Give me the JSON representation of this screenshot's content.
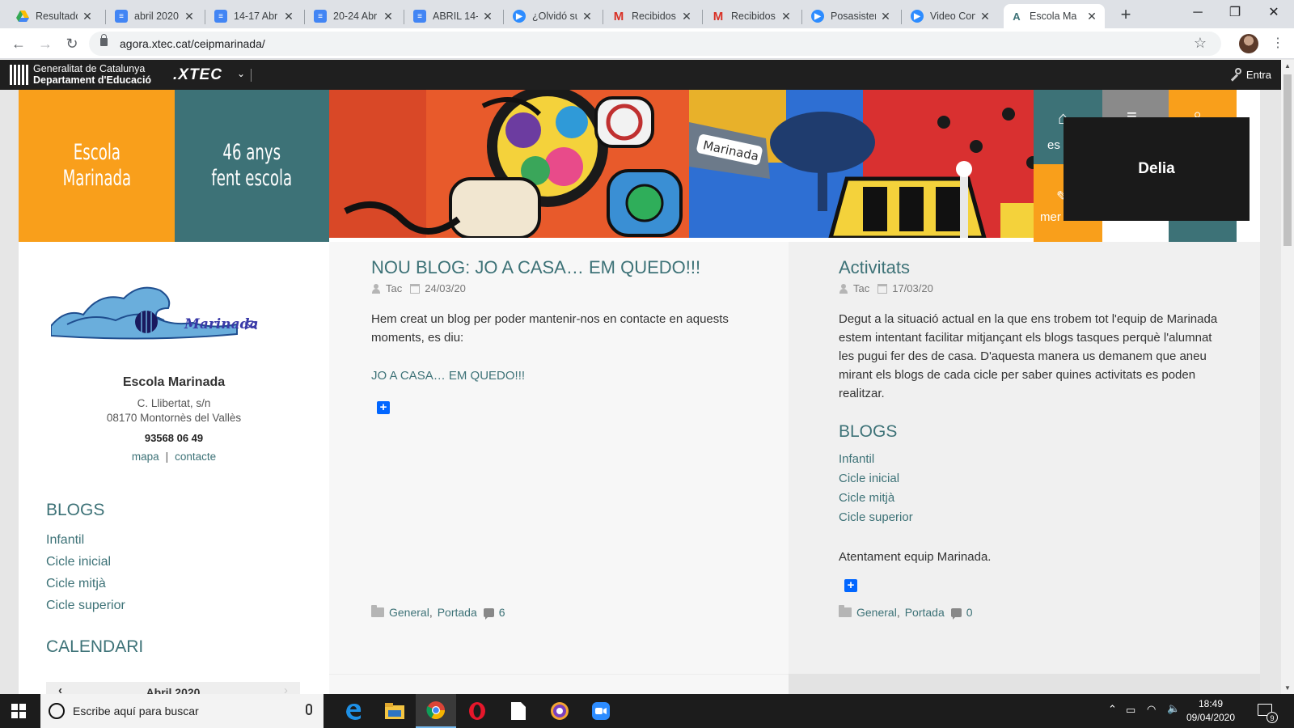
{
  "browser": {
    "tabs": [
      {
        "title": "Resultado",
        "favicon": "google-drive-icon",
        "color": "#34a853"
      },
      {
        "title": "abril 2020",
        "favicon": "google-docs-icon",
        "color": "#4285f4"
      },
      {
        "title": "14-17 Abr",
        "favicon": "google-docs-icon",
        "color": "#4285f4"
      },
      {
        "title": "20-24 Abr",
        "favicon": "google-docs-icon",
        "color": "#4285f4"
      },
      {
        "title": "ABRIL 14-",
        "favicon": "google-docs-icon",
        "color": "#4285f4"
      },
      {
        "title": "¿Olvidó su",
        "favicon": "zoom-icon",
        "color": "#2d8cff"
      },
      {
        "title": "Recibidos",
        "favicon": "gmail-icon",
        "color": "#d93025"
      },
      {
        "title": "Recibidos",
        "favicon": "gmail-icon",
        "color": "#d93025"
      },
      {
        "title": "Posasisten",
        "favicon": "zoom-icon",
        "color": "#2d8cff"
      },
      {
        "title": "Video Con",
        "favicon": "zoom-icon",
        "color": "#2d8cff"
      },
      {
        "title": "Escola Ma",
        "favicon": "agora-icon",
        "color": "#3d7277"
      }
    ],
    "url": "agora.xtec.cat/ceipmarinada/"
  },
  "site_bar": {
    "gencat_line1": "Generalitat de Catalunya",
    "gencat_line2": "Departament d'Educació",
    "xtec": ".XTEC",
    "login": "Entra"
  },
  "header": {
    "tile1_line1": "Escola",
    "tile1_line2": "Marinada",
    "tile2_line1": "46 anys",
    "tile2_line2": "fent escola",
    "nav_label_1": "es",
    "nav_label_2": "mer",
    "accent_orange": "#f99f1b",
    "accent_teal": "#3d7277"
  },
  "sidebar": {
    "logo_text": "Marinada",
    "school_name": "Escola Marinada",
    "address_line1": "C. Llibertat, s/n",
    "address_line2": "08170 Montornès del Vallès",
    "phone": "93568 06 49",
    "link_map": "mapa",
    "link_separator": "|",
    "link_contact": "contacte",
    "blogs_heading": "BLOGS",
    "blogs": [
      "Infantil",
      "Cicle inicial",
      "Cicle mitjà",
      "Cicle superior"
    ],
    "calendar_heading": "CALENDARI",
    "calendar_month": "Abril 2020",
    "calendar_prev": "‹",
    "calendar_next": "›"
  },
  "post1": {
    "title": "NOU BLOG: JO A CASA… EM QUEDO!!!",
    "author": "Tac",
    "date": "24/03/20",
    "body_line1": "Hem creat un blog per poder mantenir-nos en contacte en aquests",
    "body_line2": "moments, es diu:",
    "link": "JO A CASA… EM QUEDO!!!",
    "share": "+",
    "category1": "General",
    "category2": "Portada",
    "comments": "6"
  },
  "post2": {
    "title": "Activitats",
    "author": "Tac",
    "date": "17/03/20",
    "body": [
      "Degut a la situació actual en la que ens trobem tot l'equip de Marinada",
      "estem intentant facilitar mitjançant els blogs tasques perquè l'alumnat",
      "les pugui fer des de casa. D'aquesta manera us demanem que aneu",
      "mirant els blogs de cada cicle per saber quines activitats es poden",
      "realitzar."
    ],
    "blogs_heading": "BLOGS",
    "blogs": [
      "Infantil",
      "Cicle inicial",
      "Cicle mitjà",
      "Cicle superior"
    ],
    "signoff": "Atentament equip Marinada.",
    "share": "+",
    "category1": "General",
    "category2": "Portada",
    "comments": "0"
  },
  "popup": {
    "name": "Delia"
  },
  "taskbar": {
    "search_placeholder": "Escribe aquí para buscar",
    "time": "18:49",
    "date": "09/04/2020",
    "notifications": "9"
  }
}
